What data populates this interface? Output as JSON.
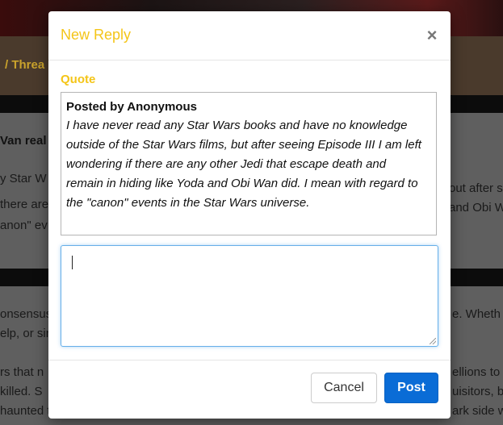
{
  "background": {
    "breadcrumb_text": "/  Threa",
    "thread_title_fragment": "Van real",
    "post_lines_left": [
      "y Star W",
      "there are",
      "anon\" ev"
    ],
    "post_lines_right": [
      "out after s",
      "and Obi W"
    ],
    "reply_lines_left": [
      "onsensus",
      "elp, or sin",
      "",
      "rs that n",
      "killed. S",
      "haunted the"
    ],
    "reply_lines_right": [
      "e. Wheth",
      "",
      "ellions to",
      "uisitors, b",
      "ark side w"
    ]
  },
  "modal": {
    "title": "New Reply",
    "close_glyph": "×",
    "quote_label": "Quote",
    "quote": {
      "author": "Posted by Anonymous",
      "text": "I have never read any Star Wars books and have no knowledge outside of the Star Wars films, but after seeing Episode III I am left wondering if there are any other Jedi that escape death and remain in hiding like Yoda and Obi Wan did. I mean with regard to the \"canon\" events in the Star Wars universe."
    },
    "reply_value": "",
    "buttons": {
      "cancel_label": "Cancel",
      "post_label": "Post"
    }
  },
  "colors": {
    "accent": "#f4c518",
    "primary_button": "#0a6cd6",
    "focus_border": "#66afe9"
  }
}
